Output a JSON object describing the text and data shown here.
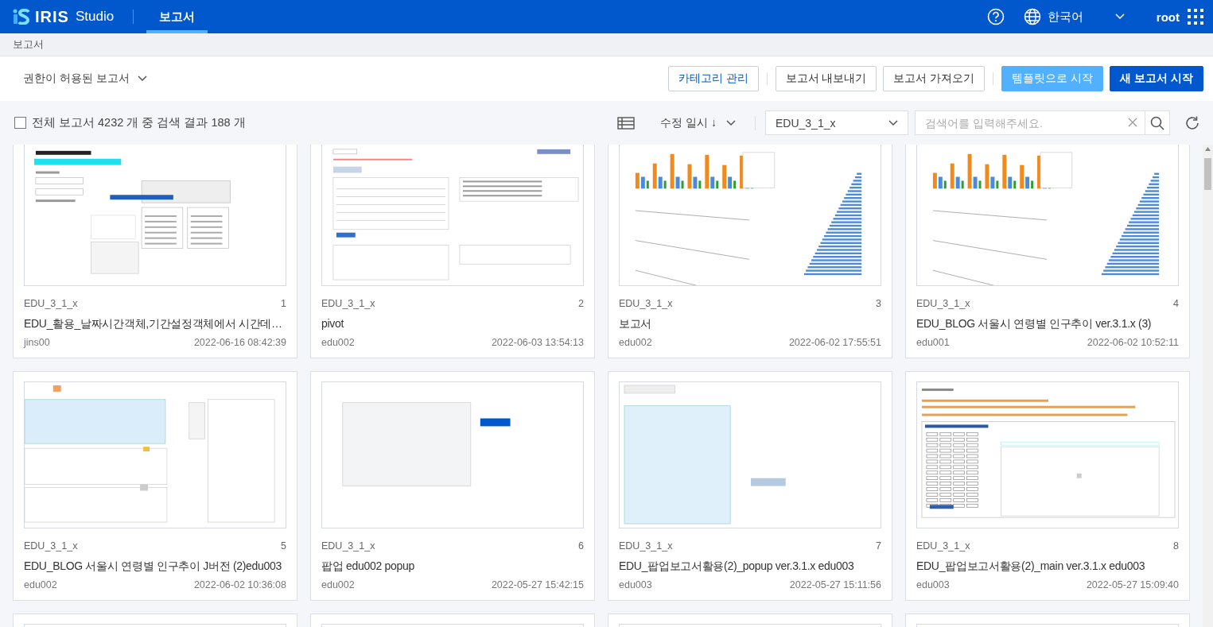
{
  "header": {
    "logo": {
      "mark": "IRIS",
      "product": "Studio"
    },
    "tabs": [
      {
        "label": "보고서",
        "selected": true
      }
    ],
    "language": "한국어",
    "user": "root"
  },
  "breadcrumb": "보고서",
  "toolbar": {
    "scope": "권한이 허용된 보고서",
    "buttons": [
      {
        "label": "카테고리 관리",
        "kind": "outline-accent",
        "divider_before": false
      },
      {
        "label": "보고서 내보내기",
        "kind": "outline",
        "divider_before": true
      },
      {
        "label": "보고서 가져오기",
        "kind": "outline",
        "divider_before": false
      },
      {
        "label": "템플릿으로 시작",
        "kind": "light",
        "divider_before": true
      },
      {
        "label": "새 보고서 시작",
        "kind": "primary",
        "divider_before": false
      }
    ]
  },
  "filter_bar": {
    "select_all": {
      "checked": false
    },
    "summary": "전체 보고서 4232 개 중 검색 결과 188 개",
    "sort": {
      "label": "수정 일시",
      "arrow": "↓"
    },
    "category": "EDU_3_1_x",
    "search": {
      "placeholder": "검색어를 입력해주세요."
    }
  },
  "reports": [
    {
      "category": "EDU_3_1_x",
      "number": "1",
      "title": "EDU_활용_날짜시간객체,기간설정객체에서 시간데…",
      "author": "jins00",
      "modified": "2022-06-16 08:42:39",
      "thumbnail": {
        "kind": "form"
      }
    },
    {
      "category": "EDU_3_1_x",
      "number": "2",
      "title": "pivot",
      "author": "edu002",
      "modified": "2022-06-03 13:54:13",
      "thumbnail": {
        "kind": "table"
      }
    },
    {
      "category": "EDU_3_1_x",
      "number": "3",
      "title": "보고서",
      "author": "edu002",
      "modified": "2022-06-02 17:55:51",
      "thumbnail": {
        "kind": "chart"
      }
    },
    {
      "category": "EDU_3_1_x",
      "number": "4",
      "title": "EDU_BLOG 서울시 연령별 인구추이 ver.3.1.x (3)",
      "author": "edu001",
      "modified": "2022-06-02 10:52:11",
      "thumbnail": {
        "kind": "chart"
      }
    },
    {
      "category": "EDU_3_1_x",
      "number": "5",
      "title": "EDU_BLOG 서울시 연령별 인구추이 J버전 (2)edu003",
      "author": "edu002",
      "modified": "2022-06-02 10:36:08",
      "thumbnail": {
        "kind": "panels"
      }
    },
    {
      "category": "EDU_3_1_x",
      "number": "6",
      "title": "팝업 edu002 popup",
      "author": "edu002",
      "modified": "2022-05-27 15:42:15",
      "thumbnail": {
        "kind": "popup"
      }
    },
    {
      "category": "EDU_3_1_x",
      "number": "7",
      "title": "EDU_팝업보고서활용(2)_popup ver.3.1.x edu003",
      "author": "edu003",
      "modified": "2022-05-27 15:11:56",
      "thumbnail": {
        "kind": "split"
      }
    },
    {
      "category": "EDU_3_1_x",
      "number": "8",
      "title": "EDU_팝업보고서활용(2)_main ver.3.1.x edu003",
      "author": "edu003",
      "modified": "2022-05-27 15:09:40",
      "thumbnail": {
        "kind": "checklist"
      }
    }
  ],
  "more_reports": [
    {
      "thumbnail": {
        "kind": "blank"
      }
    },
    {
      "thumbnail": {
        "kind": "blank"
      }
    },
    {
      "thumbnail": {
        "kind": "blank"
      }
    },
    {
      "thumbnail": {
        "kind": "blank"
      }
    }
  ]
}
